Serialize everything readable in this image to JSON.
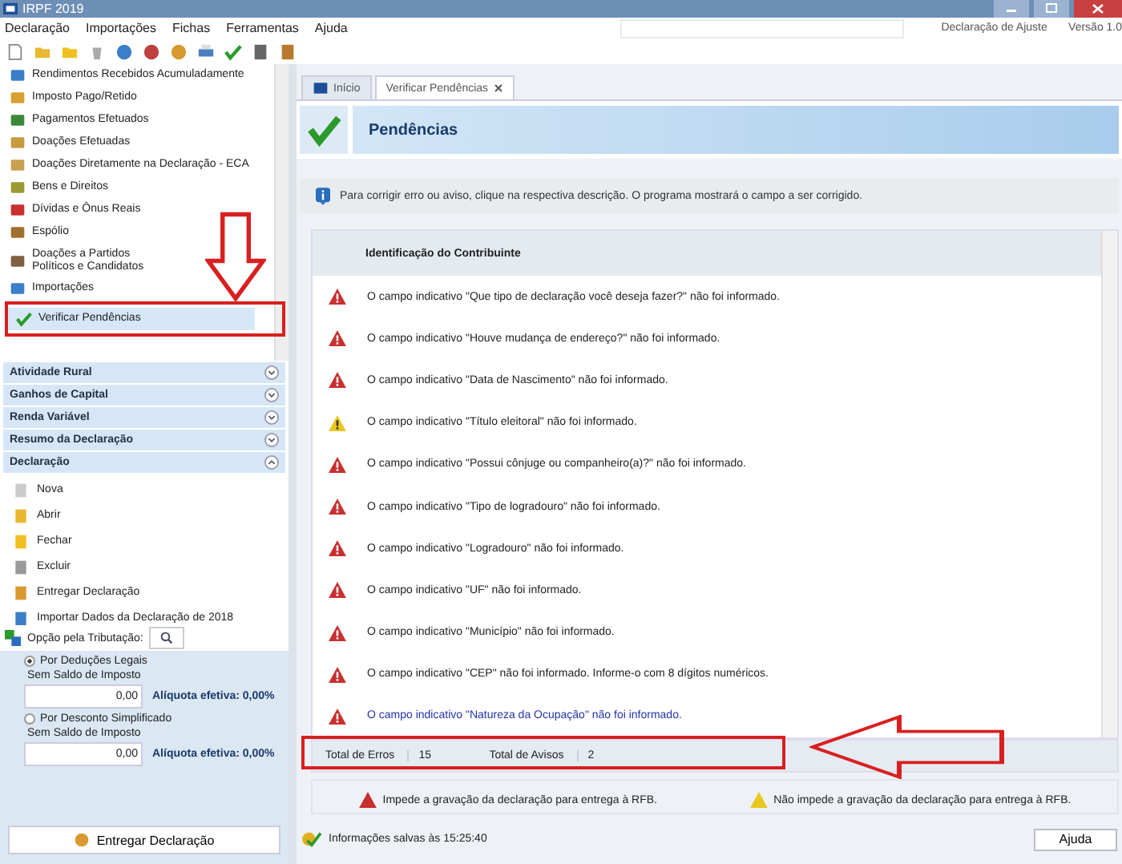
{
  "window": {
    "title": "IRPF 2019"
  },
  "menu": [
    "Declaração",
    "Importações",
    "Fichas",
    "Ferramentas",
    "Ajuda"
  ],
  "top_right": {
    "declaration_type": "Declaração de Ajuste",
    "version": "Versão 1.0"
  },
  "sidebar": {
    "items": [
      {
        "label": "Rendimentos Recebidos Acumuladamente",
        "selected": false
      },
      {
        "label": "Imposto Pago/Retido",
        "selected": false
      },
      {
        "label": "Pagamentos Efetuados",
        "selected": false
      },
      {
        "label": "Doações Efetuadas",
        "selected": false
      },
      {
        "label": "Doações Diretamente na Declaração - ECA",
        "selected": false
      },
      {
        "label": "Bens e Direitos",
        "selected": false
      },
      {
        "label": "Dívidas e Ônus Reais",
        "selected": false
      },
      {
        "label": "Espólio",
        "selected": false
      },
      {
        "label": "Doações a Partidos Políticos e Candidatos",
        "selected": false
      },
      {
        "label": "Importações",
        "selected": false
      },
      {
        "label": "Verificar Pendências",
        "selected": true
      }
    ],
    "sections": [
      {
        "label": "Atividade Rural",
        "expanded": false
      },
      {
        "label": "Ganhos de Capital",
        "expanded": false
      },
      {
        "label": "Renda Variável",
        "expanded": false
      },
      {
        "label": "Resumo da Declaração",
        "expanded": false
      },
      {
        "label": "Declaração",
        "expanded": true
      }
    ],
    "declaration_items": [
      "Nova",
      "Abrir",
      "Fechar",
      "Excluir",
      "Entregar Declaração",
      "Importar Dados da Declaração de 2018"
    ]
  },
  "taxation": {
    "title": "Opção pela Tributação:",
    "options": [
      {
        "label": "Por Deduções Legais",
        "selected": true,
        "balance_label": "Sem Saldo de Imposto",
        "value": "0,00",
        "rate": "Alíquota efetiva: 0,00%"
      },
      {
        "label": "Por Desconto Simplificado",
        "selected": false,
        "balance_label": "Sem Saldo de Imposto",
        "value": "0,00",
        "rate": "Alíquota efetiva: 0,00%"
      }
    ],
    "submit_button": "Entregar Declaração"
  },
  "tabs": [
    {
      "label": "Início",
      "selected": false,
      "closable": false
    },
    {
      "label": "Verificar Pendências",
      "selected": true,
      "closable": true
    }
  ],
  "page_title": "Pendências",
  "info": "Para corrigir erro ou aviso, clique na respectiva descrição. O programa mostrará o campo a ser corrigido.",
  "group_header": "Identificação do Contribuinte",
  "issues": [
    {
      "kind": "error",
      "text": "O campo indicativo \"Que tipo de declaração você deseja fazer?\" não foi informado.",
      "selected": false
    },
    {
      "kind": "error",
      "text": "O campo indicativo \"Houve mudança de endereço?\" não foi informado.",
      "selected": false
    },
    {
      "kind": "error",
      "text": "O campo indicativo \"Data de Nascimento\" não foi informado.",
      "selected": false
    },
    {
      "kind": "warning",
      "text": "O campo indicativo \"Título eleitoral\" não foi informado.",
      "selected": false
    },
    {
      "kind": "error",
      "text": "O campo indicativo \"Possui cônjuge ou companheiro(a)?\" não foi informado.",
      "selected": false
    },
    {
      "kind": "error",
      "text": "O campo indicativo \"Tipo de logradouro\" não foi informado.",
      "selected": false
    },
    {
      "kind": "error",
      "text": "O campo indicativo \"Logradouro\" não foi informado.",
      "selected": false
    },
    {
      "kind": "error",
      "text": "O campo indicativo \"UF\" não foi informado.",
      "selected": false
    },
    {
      "kind": "error",
      "text": "O campo indicativo \"Município\" não foi informado.",
      "selected": false
    },
    {
      "kind": "error",
      "text": "O campo indicativo \"CEP\" não foi informado. Informe-o com 8 dígitos numéricos.",
      "selected": false
    },
    {
      "kind": "error",
      "text": "O campo indicativo \"Natureza da Ocupação\" não foi informado.",
      "selected": true
    }
  ],
  "totals": [
    {
      "label": "Total de Erros",
      "value": "15"
    },
    {
      "label": "Total de Avisos",
      "value": "2"
    }
  ],
  "legend": [
    {
      "kind": "error",
      "text": "Impede a gravação da declaração para entrega à RFB."
    },
    {
      "kind": "warning",
      "text": "Não impede a gravação da declaração para entrega à RFB."
    }
  ],
  "status_bar": {
    "text": "Informações salvas às 15:25:40",
    "help_button": "Ajuda"
  },
  "annotations": [
    {
      "kind": "frame_sidebar"
    },
    {
      "kind": "arrow_down"
    },
    {
      "kind": "frame_totals"
    },
    {
      "kind": "arrow_left"
    }
  ]
}
